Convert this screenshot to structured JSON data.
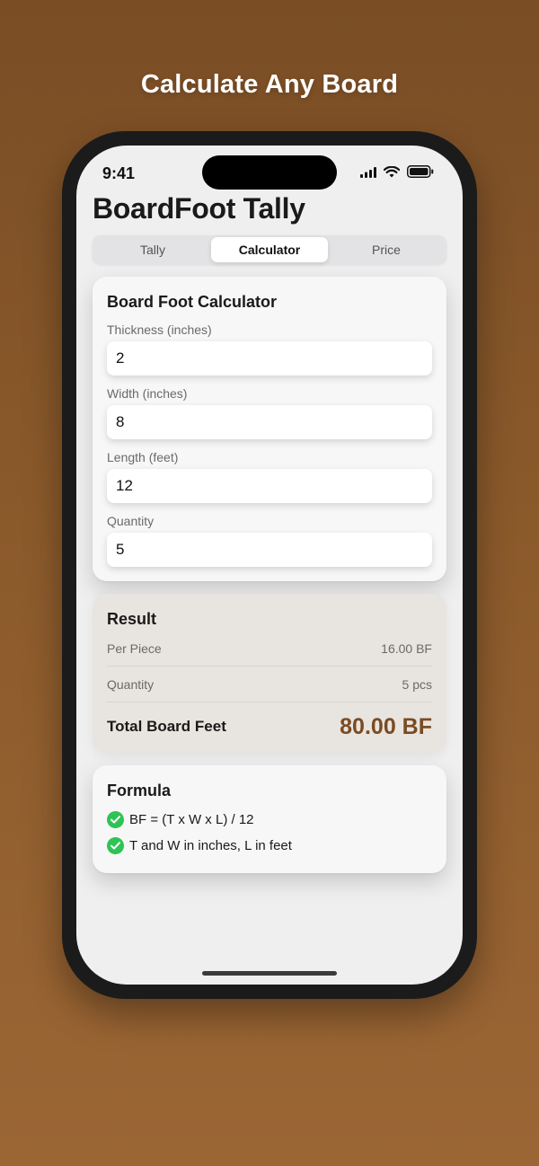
{
  "headline": "Calculate Any Board",
  "status_bar": {
    "time": "9:41"
  },
  "app": {
    "title": "BoardFoot Tally"
  },
  "tabs": [
    {
      "label": "Tally",
      "active": false
    },
    {
      "label": "Calculator",
      "active": true
    },
    {
      "label": "Price",
      "active": false
    }
  ],
  "calculator": {
    "title": "Board Foot Calculator",
    "fields": [
      {
        "label": "Thickness (inches)",
        "value": "2"
      },
      {
        "label": "Width (inches)",
        "value": "8"
      },
      {
        "label": "Length (feet)",
        "value": "12"
      },
      {
        "label": "Quantity",
        "value": "5"
      }
    ]
  },
  "result": {
    "title": "Result",
    "per_piece_label": "Per Piece",
    "per_piece_value": "16.00 BF",
    "quantity_label": "Quantity",
    "quantity_value": "5 pcs",
    "total_label": "Total Board Feet",
    "total_value": "80.00 BF"
  },
  "formula": {
    "title": "Formula",
    "items": [
      "BF = (T x W x L) / 12",
      "T and W in inches, L in feet"
    ]
  },
  "colors": {
    "accent_brown": "#7a4b22",
    "check_green": "#2fc354",
    "background_brown": "#8b5a2b"
  },
  "icons": {
    "signal": "cellular-signal-icon",
    "wifi": "wifi-icon",
    "battery": "battery-icon",
    "check": "checkmark-circle-icon"
  }
}
